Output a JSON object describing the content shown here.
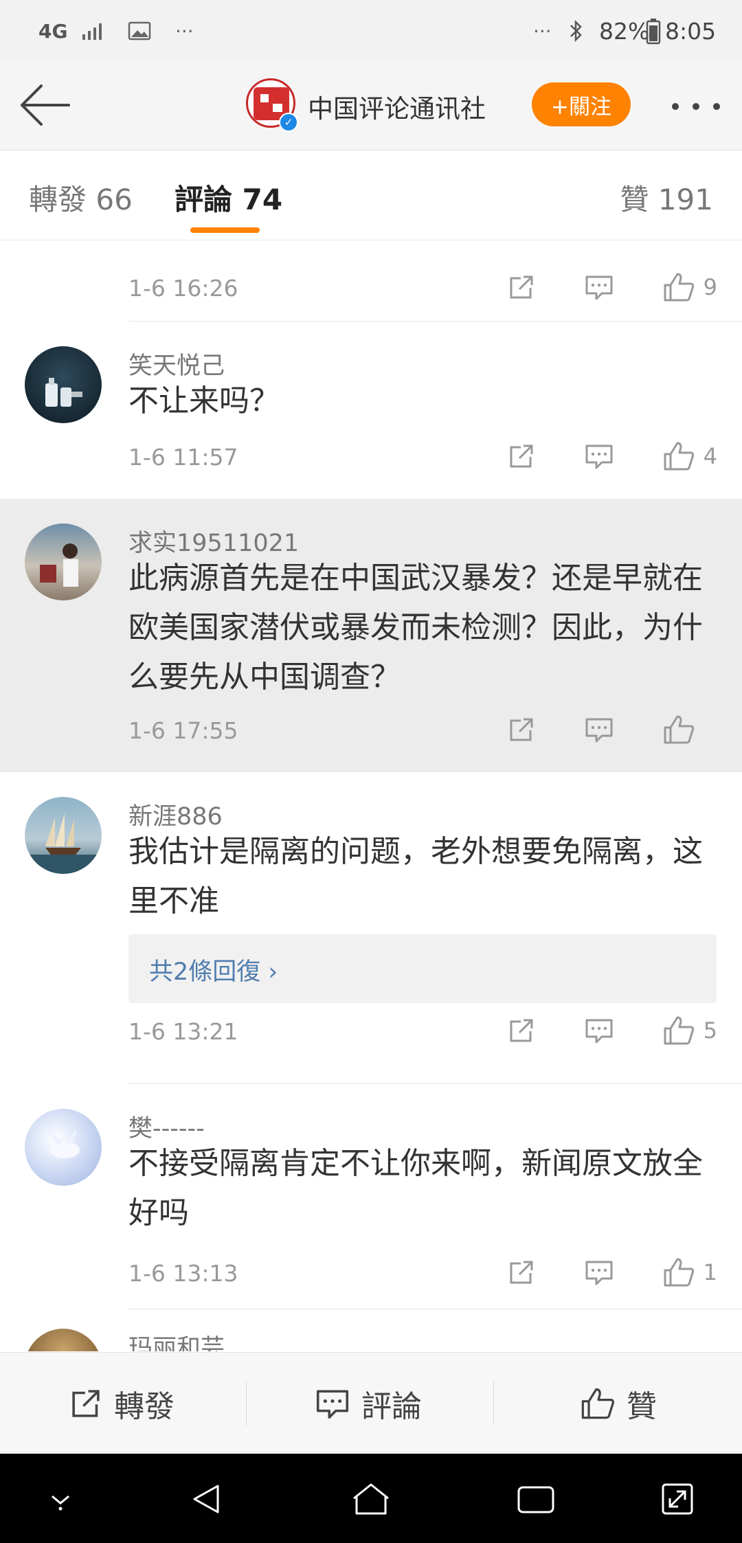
{
  "status_bar": {
    "network": "4G",
    "dots_left": "···",
    "dots_right": "···",
    "battery_percent": "82%",
    "time": "8:05"
  },
  "header": {
    "title": "中国评论通讯社",
    "follow_label": "+關注",
    "accent_color": "#ff8200"
  },
  "tabs": {
    "forward": "轉發 66",
    "comment": "評論 74",
    "like": "贊 191"
  },
  "comments": [
    {
      "time": "1-6 16:26",
      "likes": "9"
    },
    {
      "name": "笑天悦己",
      "text": "不让来吗？",
      "time": "1-6 11:57",
      "likes": "4"
    },
    {
      "name": "求实19511021",
      "text": "此病源首先是在中国武汉暴发？还是早就在欧美国家潜伏或暴发而未检测？因此，为什么要先从中国调查？",
      "time": "1-6 17:55",
      "likes": ""
    },
    {
      "name": "新涯886",
      "text": "我估计是隔离的问题，老外想要免隔离，这里不准",
      "replies": "共2條回復 ›",
      "time": "1-6 13:21",
      "likes": "5"
    },
    {
      "name": "樊------",
      "text": "不接受隔离肯定不让你来啊，新闻原文放全好吗",
      "time": "1-6 13:13",
      "likes": "1"
    },
    {
      "name": "玛丽和芸"
    }
  ],
  "bottom_bar": {
    "forward": "轉發",
    "comment": "評論",
    "like": "贊"
  },
  "icons": {
    "back": "back-arrow-icon",
    "share": "share-icon",
    "comment": "comment-icon",
    "like": "thumbs-up-icon",
    "nav_down": "chevron-down-icon",
    "nav_back": "triangle-back-icon",
    "nav_home": "home-icon",
    "nav_recent": "recent-apps-icon",
    "nav_expand": "expand-icon"
  }
}
